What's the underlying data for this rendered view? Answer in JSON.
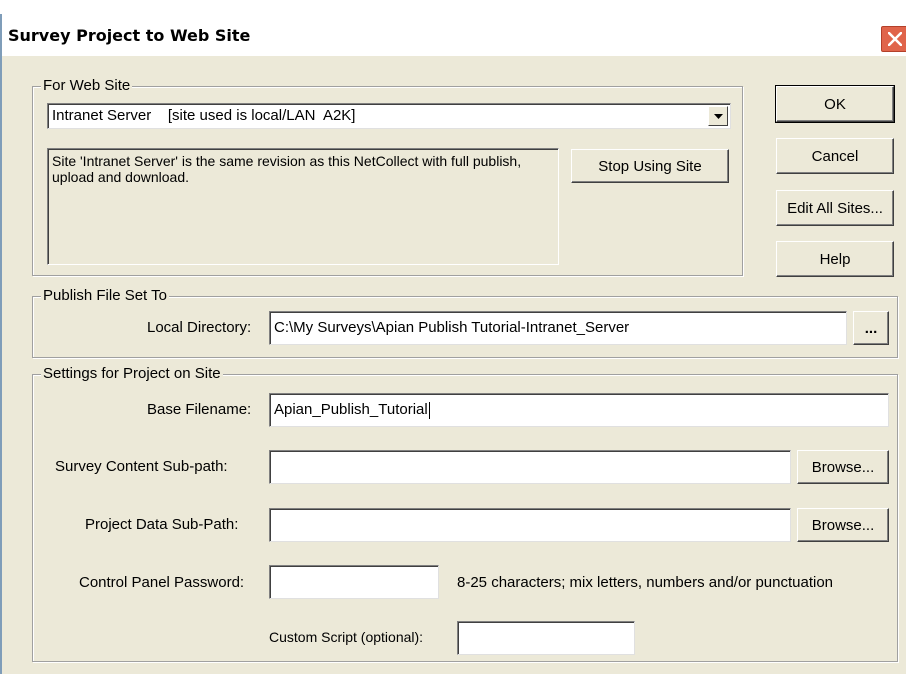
{
  "window": {
    "title": "Survey Project to Web Site",
    "title_color": "#000000",
    "close_color": "#e0644a"
  },
  "web_site": {
    "legend": "For Web Site",
    "selected_site": "Intranet Server    [site used is local/LAN  A2K]",
    "description": "Site 'Intranet Server' is the same revision as this NetCollect with full publish, upload and download.",
    "stop_button": "Stop Using Site"
  },
  "buttons": {
    "ok": "OK",
    "cancel": "Cancel",
    "edit_all_sites": "Edit All Sites...",
    "help": "Help"
  },
  "publish": {
    "legend": "Publish File Set To",
    "local_dir_label": "Local Directory:",
    "local_dir_value": "C:\\My Surveys\\Apian Publish Tutorial-Intranet_Server",
    "browse_button": "..."
  },
  "settings": {
    "legend": "Settings for Project on Site",
    "base_filename_label": "Base Filename:",
    "base_filename_value": "Apian_Publish_Tutorial",
    "content_subpath_label": "Survey Content Sub-path:",
    "content_subpath_value": "",
    "data_subpath_label": "Project Data Sub-Path:",
    "data_subpath_value": "",
    "browse_label": "Browse...",
    "password_label": "Control Panel Password:",
    "password_value": "",
    "password_hint": "8-25 characters; mix letters, numbers and/or punctuation",
    "custom_script_label": "Custom Script (optional):",
    "custom_script_value": ""
  }
}
